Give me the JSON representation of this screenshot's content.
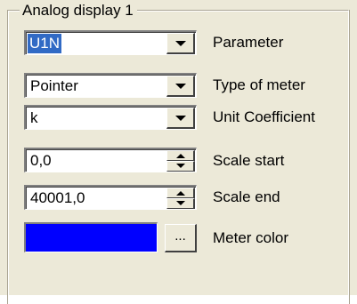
{
  "group": {
    "title": "Analog display 1"
  },
  "parameter": {
    "value": "U1N",
    "label": "Parameter"
  },
  "meter_type": {
    "value": "Pointer",
    "label": "Type of meter"
  },
  "unit_coefficient": {
    "value": "k",
    "label": "Unit Coefficient"
  },
  "scale_start": {
    "value": "0,0",
    "label": "Scale start"
  },
  "scale_end": {
    "value": "40001,0",
    "label": "Scale end"
  },
  "meter_color": {
    "label": "Meter color",
    "color": "#0000ff",
    "browse_label": "..."
  },
  "colors": {
    "panel_background": "#ece9d8",
    "selection_highlight": "#316ac5"
  }
}
